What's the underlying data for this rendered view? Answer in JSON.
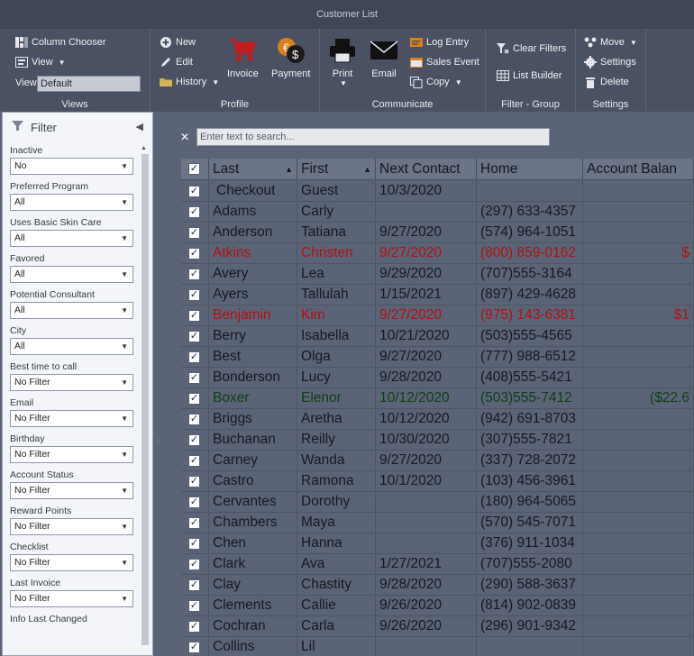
{
  "window": {
    "title": "Customer List"
  },
  "ribbon": {
    "views": {
      "label": "Views",
      "column_chooser": "Column Chooser",
      "view_menu": "View",
      "view_label": "View",
      "view_value": "Default"
    },
    "profile": {
      "label": "Profile",
      "new": "New",
      "edit": "Edit",
      "history": "History",
      "invoice": "Invoice",
      "payment": "Payment"
    },
    "communicate": {
      "label": "Communicate",
      "print": "Print",
      "email": "Email",
      "log_entry": "Log Entry",
      "sales_event": "Sales Event",
      "copy": "Copy"
    },
    "filter_group": {
      "label": "Filter - Group",
      "clear_filters": "Clear Filters",
      "list_builder": "List Builder"
    },
    "settings": {
      "label": "Settings",
      "move": "Move",
      "settings": "Settings",
      "delete": "Delete"
    }
  },
  "filter": {
    "title": "Filter",
    "fields": [
      {
        "label": "Inactive",
        "value": "No"
      },
      {
        "label": "Preferred Program",
        "value": "All"
      },
      {
        "label": "Uses Basic Skin Care",
        "value": "All"
      },
      {
        "label": "Favored",
        "value": "All"
      },
      {
        "label": "Potential Consultant",
        "value": "All"
      },
      {
        "label": "City",
        "value": "All"
      },
      {
        "label": "Best time to call",
        "value": "No Filter"
      },
      {
        "label": "Email",
        "value": "No Filter"
      },
      {
        "label": "Birthday",
        "value": "No Filter"
      },
      {
        "label": "Account Status",
        "value": "No Filter"
      },
      {
        "label": "Reward Points",
        "value": "No Filter"
      },
      {
        "label": "Checklist",
        "value": "No Filter"
      },
      {
        "label": "Last Invoice",
        "value": "No Filter"
      },
      {
        "label": "Info Last Changed",
        "value": ""
      }
    ]
  },
  "search": {
    "placeholder": "Enter text to search..."
  },
  "grid": {
    "columns": [
      "Last",
      "First",
      "Next Contact",
      "Home",
      "Account Balan"
    ],
    "rows": [
      {
        "last": "Checkout",
        "first": "Guest",
        "next": "10/3/2020",
        "home": "",
        "bal": "",
        "style": ""
      },
      {
        "last": "Adams",
        "first": "Carly",
        "next": "",
        "home": "(297) 633-4357",
        "bal": "",
        "style": ""
      },
      {
        "last": "Anderson",
        "first": "Tatiana",
        "next": "9/27/2020",
        "home": "(574) 964-1051",
        "bal": "",
        "style": ""
      },
      {
        "last": "Atkins",
        "first": "Christen",
        "next": "9/27/2020",
        "home": "(800) 859-0162",
        "bal": "$",
        "style": "red"
      },
      {
        "last": "Avery",
        "first": "Lea",
        "next": "9/29/2020",
        "home": "(707)555-3164",
        "bal": "",
        "style": ""
      },
      {
        "last": "Ayers",
        "first": "Tallulah",
        "next": "1/15/2021",
        "home": "(897) 429-4628",
        "bal": "",
        "style": ""
      },
      {
        "last": "Benjamin",
        "first": "Kim",
        "next": "9/27/2020",
        "home": "(975) 143-6381",
        "bal": "$1",
        "style": "red"
      },
      {
        "last": "Berry",
        "first": "Isabella",
        "next": "10/21/2020",
        "home": "(503)555-4565",
        "bal": "",
        "style": ""
      },
      {
        "last": "Best",
        "first": "Olga",
        "next": "9/27/2020",
        "home": "(777) 988-6512",
        "bal": "",
        "style": ""
      },
      {
        "last": "Bonderson",
        "first": "Lucy",
        "next": "9/28/2020",
        "home": "(408)555-5421",
        "bal": "",
        "style": ""
      },
      {
        "last": "Boxer",
        "first": "Elenor",
        "next": "10/12/2020",
        "home": "(503)555-7412",
        "bal": "($22.6",
        "style": "green"
      },
      {
        "last": "Briggs",
        "first": "Aretha",
        "next": "10/12/2020",
        "home": "(942) 691-8703",
        "bal": "",
        "style": ""
      },
      {
        "last": "Buchanan",
        "first": "Reilly",
        "next": "10/30/2020",
        "home": "(307)555-7821",
        "bal": "",
        "style": ""
      },
      {
        "last": "Carney",
        "first": "Wanda",
        "next": "9/27/2020",
        "home": "(337) 728-2072",
        "bal": "",
        "style": ""
      },
      {
        "last": "Castro",
        "first": "Ramona",
        "next": "10/1/2020",
        "home": "(103) 456-3961",
        "bal": "",
        "style": ""
      },
      {
        "last": "Cervantes",
        "first": "Dorothy",
        "next": "",
        "home": "(180) 964-5065",
        "bal": "",
        "style": ""
      },
      {
        "last": "Chambers",
        "first": "Maya",
        "next": "",
        "home": "(570) 545-7071",
        "bal": "",
        "style": ""
      },
      {
        "last": "Chen",
        "first": "Hanna",
        "next": "",
        "home": "(376) 911-1034",
        "bal": "",
        "style": ""
      },
      {
        "last": "Clark",
        "first": "Ava",
        "next": "1/27/2021",
        "home": "(707)555-2080",
        "bal": "",
        "style": ""
      },
      {
        "last": "Clay",
        "first": "Chastity",
        "next": "9/28/2020",
        "home": "(290) 588-3637",
        "bal": "",
        "style": ""
      },
      {
        "last": "Clements",
        "first": "Callie",
        "next": "9/26/2020",
        "home": "(814) 902-0839",
        "bal": "",
        "style": ""
      },
      {
        "last": "Cochran",
        "first": "Carla",
        "next": "9/26/2020",
        "home": "(296) 901-9342",
        "bal": "",
        "style": ""
      },
      {
        "last": "Collins",
        "first": "Lil",
        "next": "",
        "home": "",
        "bal": "",
        "style": ""
      }
    ]
  },
  "colors": {
    "red_text": "#b01010",
    "green_text": "#0f3d12"
  }
}
